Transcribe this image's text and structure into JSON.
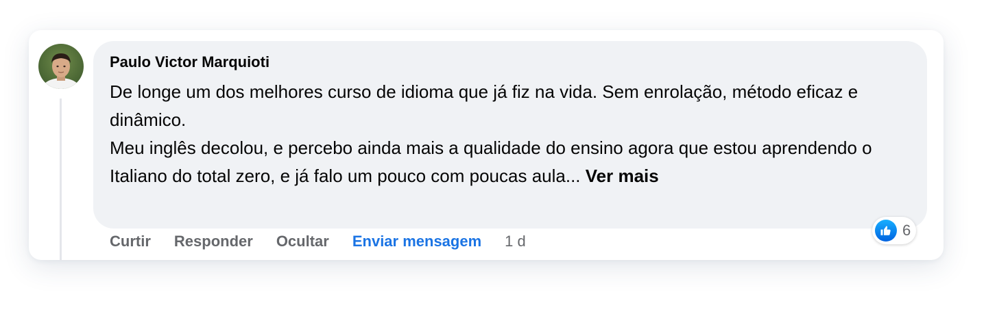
{
  "comment": {
    "author": "Paulo Victor Marquioti",
    "paragraphs": [
      "De longe um dos melhores curso de idioma que já fiz na vida. Sem enrolação, método eficaz e dinâmico.",
      "Meu inglês decolou, e percebo ainda mais a qualidade do ensino agora que estou aprendendo o Italiano do total zero, e já falo um pouco com poucas aula..."
    ],
    "see_more_label": "Ver mais",
    "reaction_count": "6",
    "reaction_icon": "like-icon",
    "timestamp": "1 d"
  },
  "actions": {
    "like_label": "Curtir",
    "reply_label": "Responder",
    "hide_label": "Ocultar",
    "send_message_label": "Enviar mensagem"
  },
  "colors": {
    "bubble_background": "#f0f2f5",
    "action_text": "#65676b",
    "link_blue": "#1b74e4",
    "like_blue": "#0866ff"
  }
}
